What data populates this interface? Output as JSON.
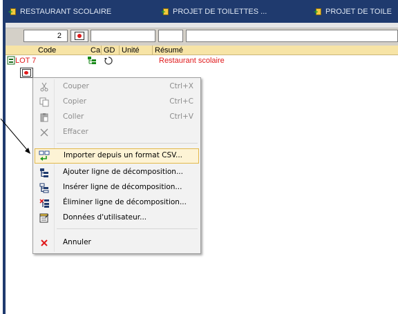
{
  "tabs": [
    {
      "label": "RESTAURANT SCOLAIRE"
    },
    {
      "label": "PROJET DE TOILETTES ..."
    },
    {
      "label": "PROJET DE TOILE"
    }
  ],
  "toolbar": {
    "field1_value": "2"
  },
  "grid": {
    "columns": [
      "Code",
      "Ca",
      "GD",
      "Unité",
      "Résumé"
    ],
    "row": {
      "code": "LOT 7",
      "resume": "Restaurant scolaire"
    }
  },
  "context_menu": {
    "items": [
      {
        "label": "Couper",
        "shortcut": "Ctrl+X",
        "icon": "scissors-icon",
        "enabled": false
      },
      {
        "label": "Copier",
        "shortcut": "Ctrl+C",
        "icon": "copy-icon",
        "enabled": false
      },
      {
        "label": "Coller",
        "shortcut": "Ctrl+V",
        "icon": "paste-icon",
        "enabled": false
      },
      {
        "label": "Effacer",
        "shortcut": "",
        "icon": "delete-x-icon",
        "enabled": false
      },
      {
        "label": "Importer depuis un format CSV...",
        "shortcut": "",
        "icon": "import-csv-icon",
        "enabled": true,
        "highlighted": true
      },
      {
        "label": "Ajouter ligne de décomposition...",
        "shortcut": "",
        "icon": "add-line-icon",
        "enabled": true
      },
      {
        "label": "Insérer ligne de décomposition...",
        "shortcut": "",
        "icon": "insert-line-icon",
        "enabled": true
      },
      {
        "label": "Éliminer ligne de décomposition...",
        "shortcut": "",
        "icon": "remove-line-icon",
        "enabled": true
      },
      {
        "label": "Données d'utilisateur...",
        "shortcut": "",
        "icon": "user-data-icon",
        "enabled": true
      },
      {
        "label": "Annuler",
        "shortcut": "",
        "icon": "cancel-icon",
        "enabled": true
      }
    ]
  },
  "colors": {
    "tab_bar": "#1f3a6e",
    "header_bg": "#f7e4a6",
    "red_text": "#e0191b",
    "highlight_bg": "#fdf3d5",
    "highlight_border": "#e2b84a"
  }
}
